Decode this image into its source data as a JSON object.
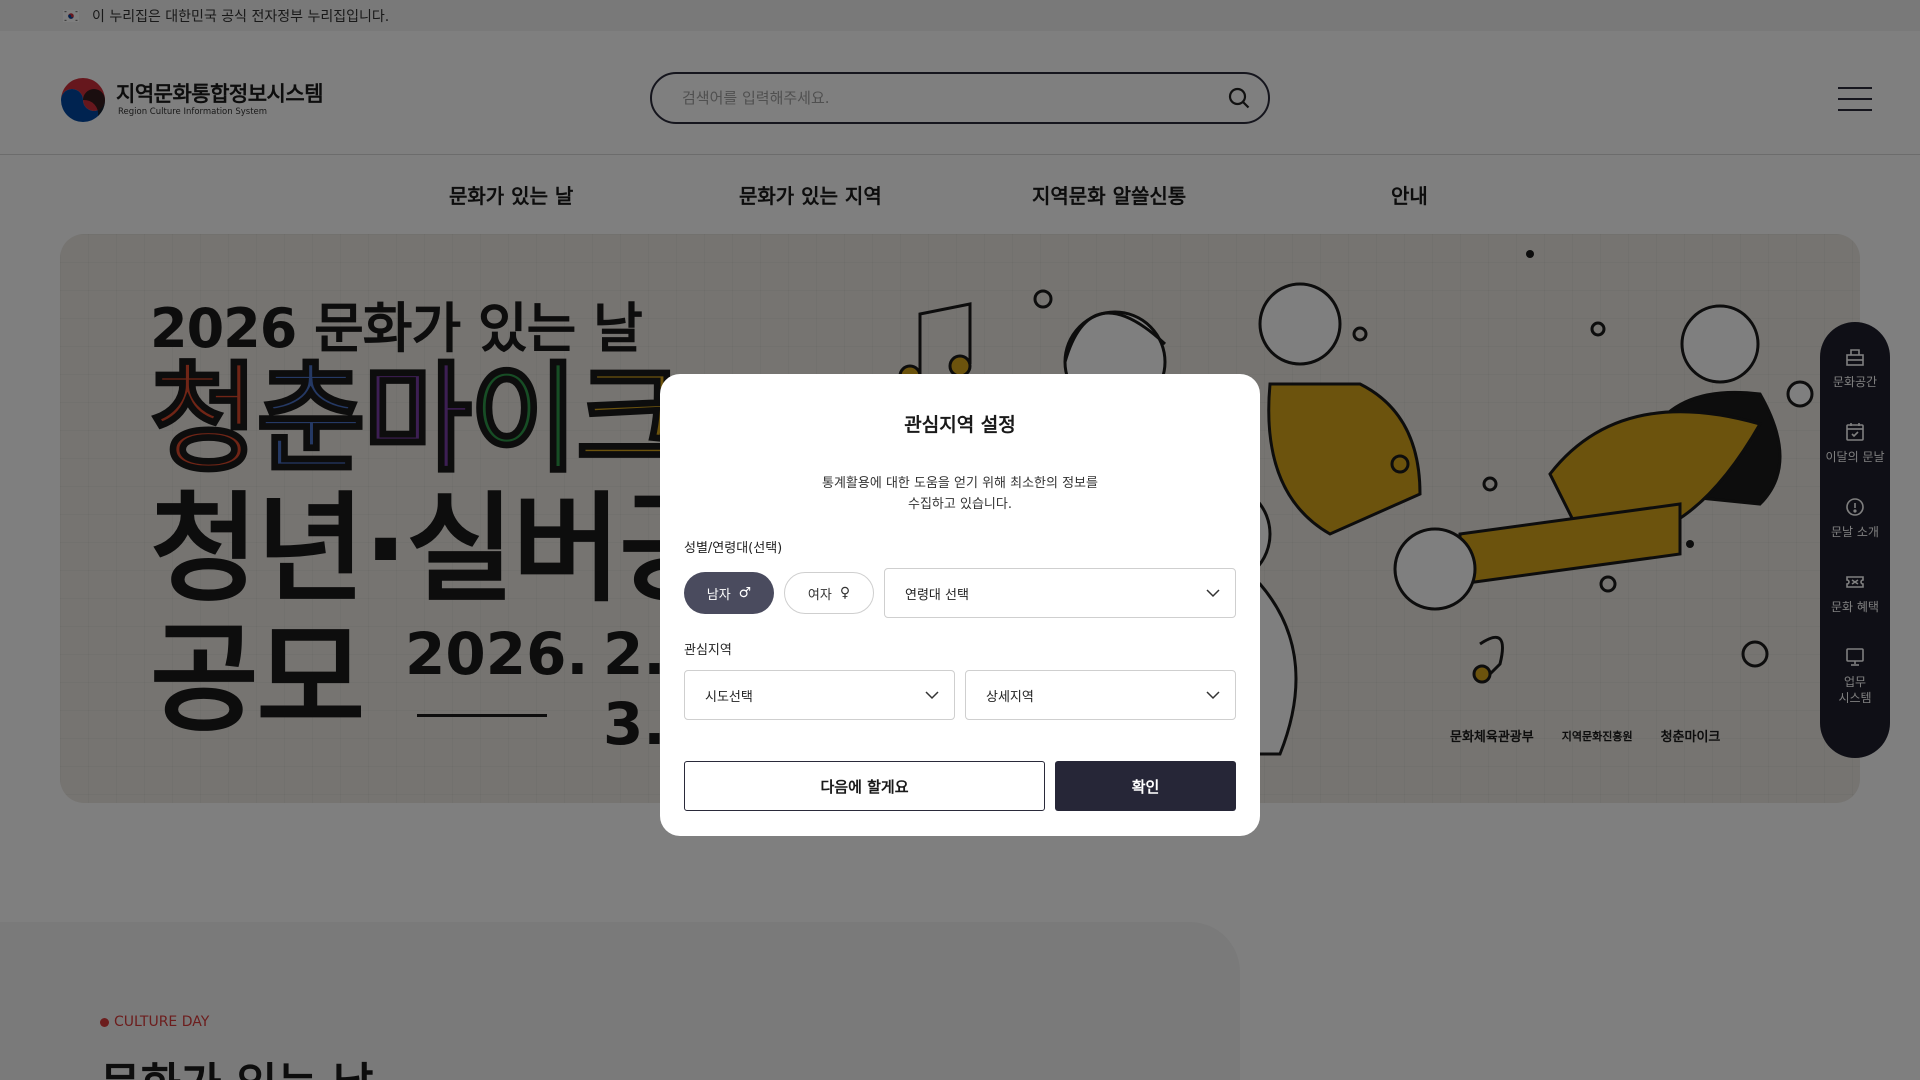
{
  "gov_notice": {
    "text": "이 누리집은 대한민국 공식 전자정부 누리집입니다."
  },
  "header": {
    "logo_title": "지역문화통합정보시스템",
    "logo_subtitle": "Region Culture Information System",
    "search_placeholder": "검색어를 입력해주세요."
  },
  "gnb": [
    {
      "label": "문화가 있는 날"
    },
    {
      "label": "문화가 있는 지역"
    },
    {
      "label": "지역문화 알쓸신통"
    },
    {
      "label": "안내"
    }
  ],
  "hero": {
    "line1": "2026 문화가 있는 날",
    "line2": [
      "청",
      "춘",
      "마",
      "이",
      "크"
    ],
    "line2_colors": [
      "#e04a2c",
      "#4a73c9",
      "#7b3fa8",
      "#2e9a4a",
      "#d9a61b"
    ],
    "line3": "청년·실버공",
    "line4": "공모",
    "date_year": "2026.",
    "date_a": "2.",
    "date_b": "3.",
    "sponsors": [
      "문화체육관광부",
      "지역문화진흥원",
      "청춘마이크"
    ]
  },
  "quick_menu": [
    {
      "label": "문화공간",
      "icon": "building-icon"
    },
    {
      "label": "이달의 문날",
      "icon": "calendar-check-icon"
    },
    {
      "label": "문날 소개",
      "icon": "info-icon"
    },
    {
      "label": "문화 혜택",
      "icon": "ticket-icon"
    },
    {
      "label": "업무\n시스템",
      "icon": "monitor-icon"
    }
  ],
  "culture_section": {
    "tag": "CULTURE DAY",
    "heading": "문화가 있는 날"
  },
  "modal": {
    "title": "관심지역 설정",
    "description": "통계활용에 대한 도움을 얻기 위해 최소한의 정보를\n수집하고 있습니다.",
    "gender_age_label": "성별/연령대(선택)",
    "male_label": "남자",
    "female_label": "여자",
    "age_select": "연령대 선택",
    "region_label": "관심지역",
    "province_select": "시도선택",
    "detail_select": "상세지역",
    "later_button": "다음에 할게요",
    "confirm_button": "확인"
  }
}
